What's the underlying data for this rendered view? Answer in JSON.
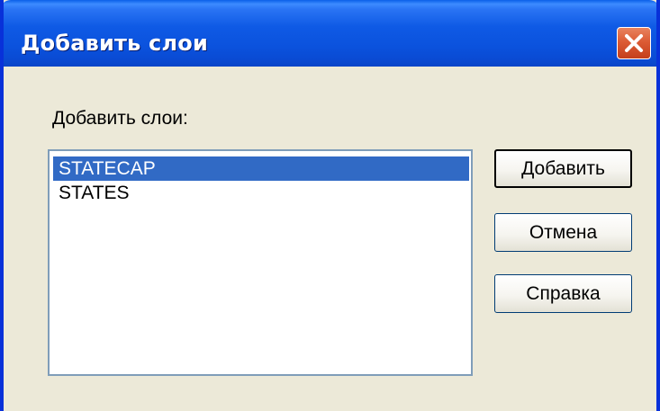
{
  "window": {
    "title": "Добавить слои"
  },
  "dialog": {
    "list_label": "Добавить слои:",
    "layers": [
      "STATECAP",
      "STATES"
    ],
    "selected_layer": "STATECAP"
  },
  "buttons": {
    "add_label": "Добавить",
    "cancel_label": "Отмена",
    "help_label": "Справка"
  },
  "icons": {
    "close": "close-icon"
  },
  "colors": {
    "titlebar": "#0a4bd4",
    "window_bg": "#ece9d8",
    "selection": "#316ac5",
    "close_button": "#dc5b34"
  }
}
